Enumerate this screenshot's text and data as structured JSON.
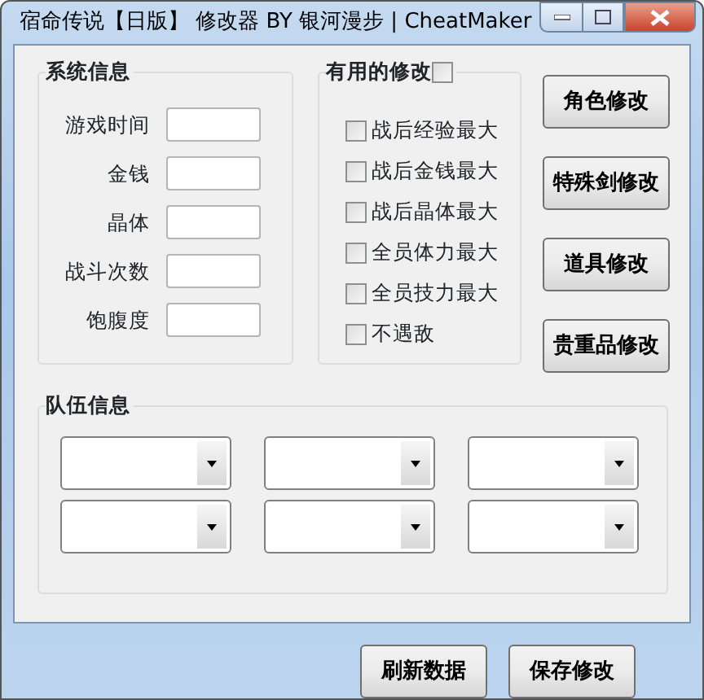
{
  "window": {
    "title": "宿命传说【日版】 修改器 BY 银河漫步 | CheatMaker"
  },
  "system_info": {
    "title": "系统信息",
    "fields": [
      {
        "label": "游戏时间"
      },
      {
        "label": "金钱"
      },
      {
        "label": "晶体"
      },
      {
        "label": "战斗次数"
      },
      {
        "label": "饱腹度"
      }
    ]
  },
  "useful_mods": {
    "title": "有用的修改",
    "checked": false,
    "options": [
      {
        "label": "战后经验最大",
        "checked": false
      },
      {
        "label": "战后金钱最大",
        "checked": false
      },
      {
        "label": "战后晶体最大",
        "checked": false
      },
      {
        "label": "全员体力最大",
        "checked": false
      },
      {
        "label": "全员技力最大",
        "checked": false
      },
      {
        "label": "不遇敌",
        "checked": false
      }
    ]
  },
  "side_buttons": [
    "角色修改",
    "特殊剑修改",
    "道具修改",
    "贵重品修改"
  ],
  "team_info": {
    "title": "队伍信息",
    "dropdowns": [
      {
        "kind": "combo"
      },
      {
        "kind": "combo"
      },
      {
        "kind": "combo"
      },
      {
        "kind": "combo"
      },
      {
        "kind": "combo"
      },
      {
        "kind": "combo"
      }
    ]
  },
  "bottom_buttons": [
    "刷新数据",
    "保存修改"
  ]
}
